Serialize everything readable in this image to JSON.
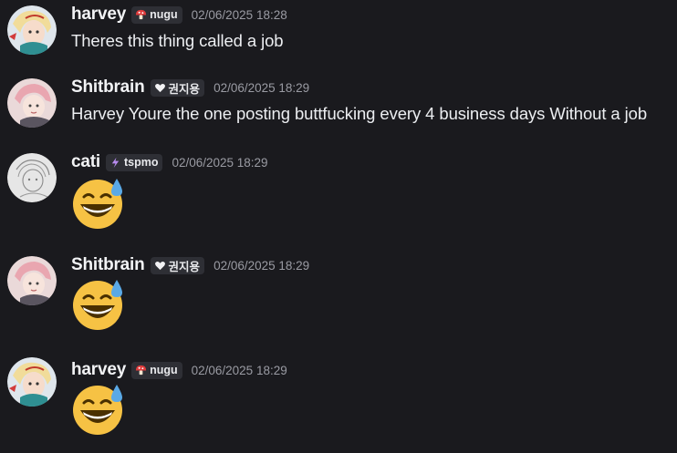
{
  "messages": [
    {
      "username": "harvey",
      "tag": {
        "label": "nugu",
        "icon": "mushroom-icon"
      },
      "timestamp": "02/06/2025 18:28",
      "content": "Theres this thing called a job"
    },
    {
      "username": "Shitbrain",
      "tag": {
        "label": "권지용",
        "icon": "heart-icon"
      },
      "timestamp": "02/06/2025 18:29",
      "content": "Harvey Youre the one posting buttfucking every 4 business days Without a job"
    },
    {
      "username": "cati",
      "tag": {
        "label": "tspmo",
        "icon": "lightning-icon"
      },
      "timestamp": "02/06/2025 18:29",
      "emoji": "sweat-smile-emoji"
    },
    {
      "username": "Shitbrain",
      "tag": {
        "label": "권지용",
        "icon": "heart-icon"
      },
      "timestamp": "02/06/2025 18:29",
      "emoji": "sweat-smile-emoji"
    },
    {
      "username": "harvey",
      "tag": {
        "label": "nugu",
        "icon": "mushroom-icon"
      },
      "timestamp": "02/06/2025 18:29",
      "emoji": "sweat-smile-emoji"
    }
  ],
  "colors": {
    "background": "#1a1a1e",
    "username": "#f2f3f5",
    "timestamp": "#9a9ba3",
    "tag_background": "#2e2f35"
  }
}
